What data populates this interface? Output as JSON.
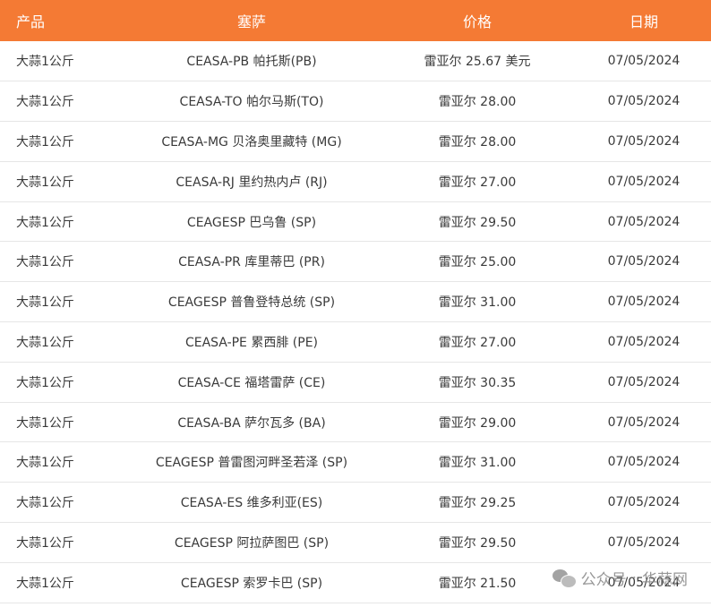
{
  "table": {
    "headers": [
      "产品",
      "塞萨",
      "价格",
      "日期"
    ],
    "rows": [
      [
        "大蒜1公斤",
        "CEASA-PB 帕托斯(PB)",
        "雷亚尔 25.67 美元",
        "07/05/2024"
      ],
      [
        "大蒜1公斤",
        "CEASA-TO 帕尔马斯(TO)",
        "雷亚尔 28.00",
        "07/05/2024"
      ],
      [
        "大蒜1公斤",
        "CEASA-MG 贝洛奥里藏特 (MG)",
        "雷亚尔 28.00",
        "07/05/2024"
      ],
      [
        "大蒜1公斤",
        "CEASA-RJ 里约热内卢 (RJ)",
        "雷亚尔 27.00",
        "07/05/2024"
      ],
      [
        "大蒜1公斤",
        "CEAGESP 巴乌鲁 (SP)",
        "雷亚尔 29.50",
        "07/05/2024"
      ],
      [
        "大蒜1公斤",
        "CEASA-PR 库里蒂巴 (PR)",
        "雷亚尔 25.00",
        "07/05/2024"
      ],
      [
        "大蒜1公斤",
        "CEAGESP 普鲁登特总统 (SP)",
        "雷亚尔 31.00",
        "07/05/2024"
      ],
      [
        "大蒜1公斤",
        "CEASA-PE 累西腓 (PE)",
        "雷亚尔 27.00",
        "07/05/2024"
      ],
      [
        "大蒜1公斤",
        "CEASA-CE 福塔雷萨 (CE)",
        "雷亚尔 30.35",
        "07/05/2024"
      ],
      [
        "大蒜1公斤",
        "CEASA-BA 萨尔瓦多 (BA)",
        "雷亚尔 29.00",
        "07/05/2024"
      ],
      [
        "大蒜1公斤",
        "CEAGESP 普雷图河畔圣若泽 (SP)",
        "雷亚尔 31.00",
        "07/05/2024"
      ],
      [
        "大蒜1公斤",
        "CEASA-ES 维多利亚(ES)",
        "雷亚尔 29.25",
        "07/05/2024"
      ],
      [
        "大蒜1公斤",
        "CEAGESP 阿拉萨图巴 (SP)",
        "雷亚尔 29.50",
        "07/05/2024"
      ],
      [
        "大蒜1公斤",
        "CEAGESP 索罗卡巴 (SP)",
        "雷亚尔 21.50",
        "07/05/2024"
      ]
    ]
  },
  "watermark": {
    "icon": "wechat-icon",
    "account": "公众号",
    "separator": "·",
    "name": "华蒜网"
  }
}
